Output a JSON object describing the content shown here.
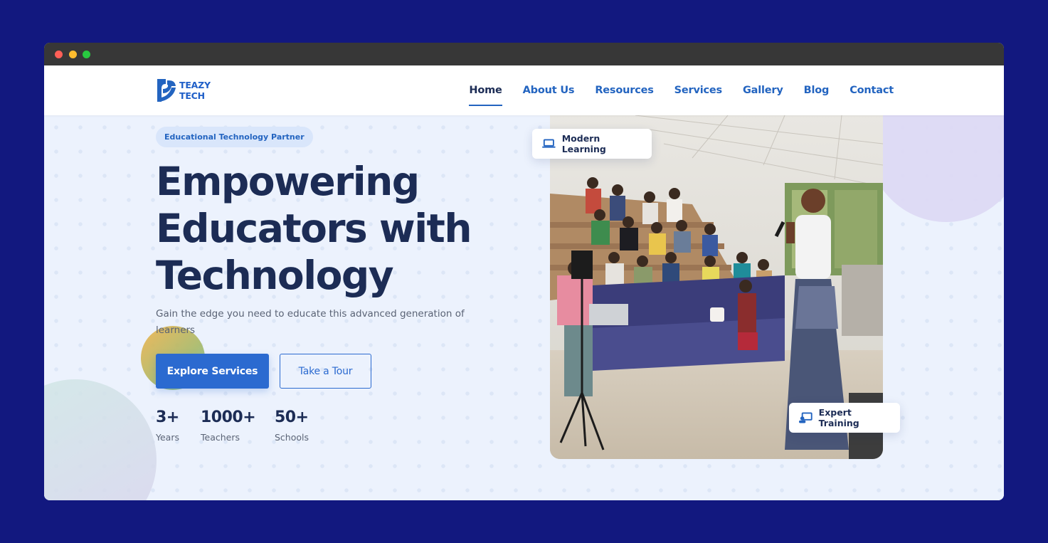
{
  "nav": {
    "logo_line1": "TEAZY",
    "logo_line2": "TECH",
    "links": [
      "Home",
      "About Us",
      "Resources",
      "Services",
      "Gallery",
      "Blog",
      "Contact"
    ],
    "active": "Home"
  },
  "hero": {
    "badge": "Educational Technology Partner",
    "headline_line1": "Empowering",
    "headline_line2": "Educators with",
    "headline_line3": "Technology",
    "subtitle": "Gain the edge you need to educate this advanced generation of learners",
    "primary_button": "Explore Services",
    "secondary_button": "Take a Tour",
    "stats": [
      {
        "value": "3+",
        "label": "Years"
      },
      {
        "value": "1000+",
        "label": "Teachers"
      },
      {
        "value": "50+",
        "label": "Schools"
      }
    ],
    "card_modern": "Modern Learning",
    "card_expert": "Expert Training"
  },
  "colors": {
    "page_bg": "#12187f",
    "primary": "#2b6ad0",
    "heading": "#1c2c55"
  }
}
